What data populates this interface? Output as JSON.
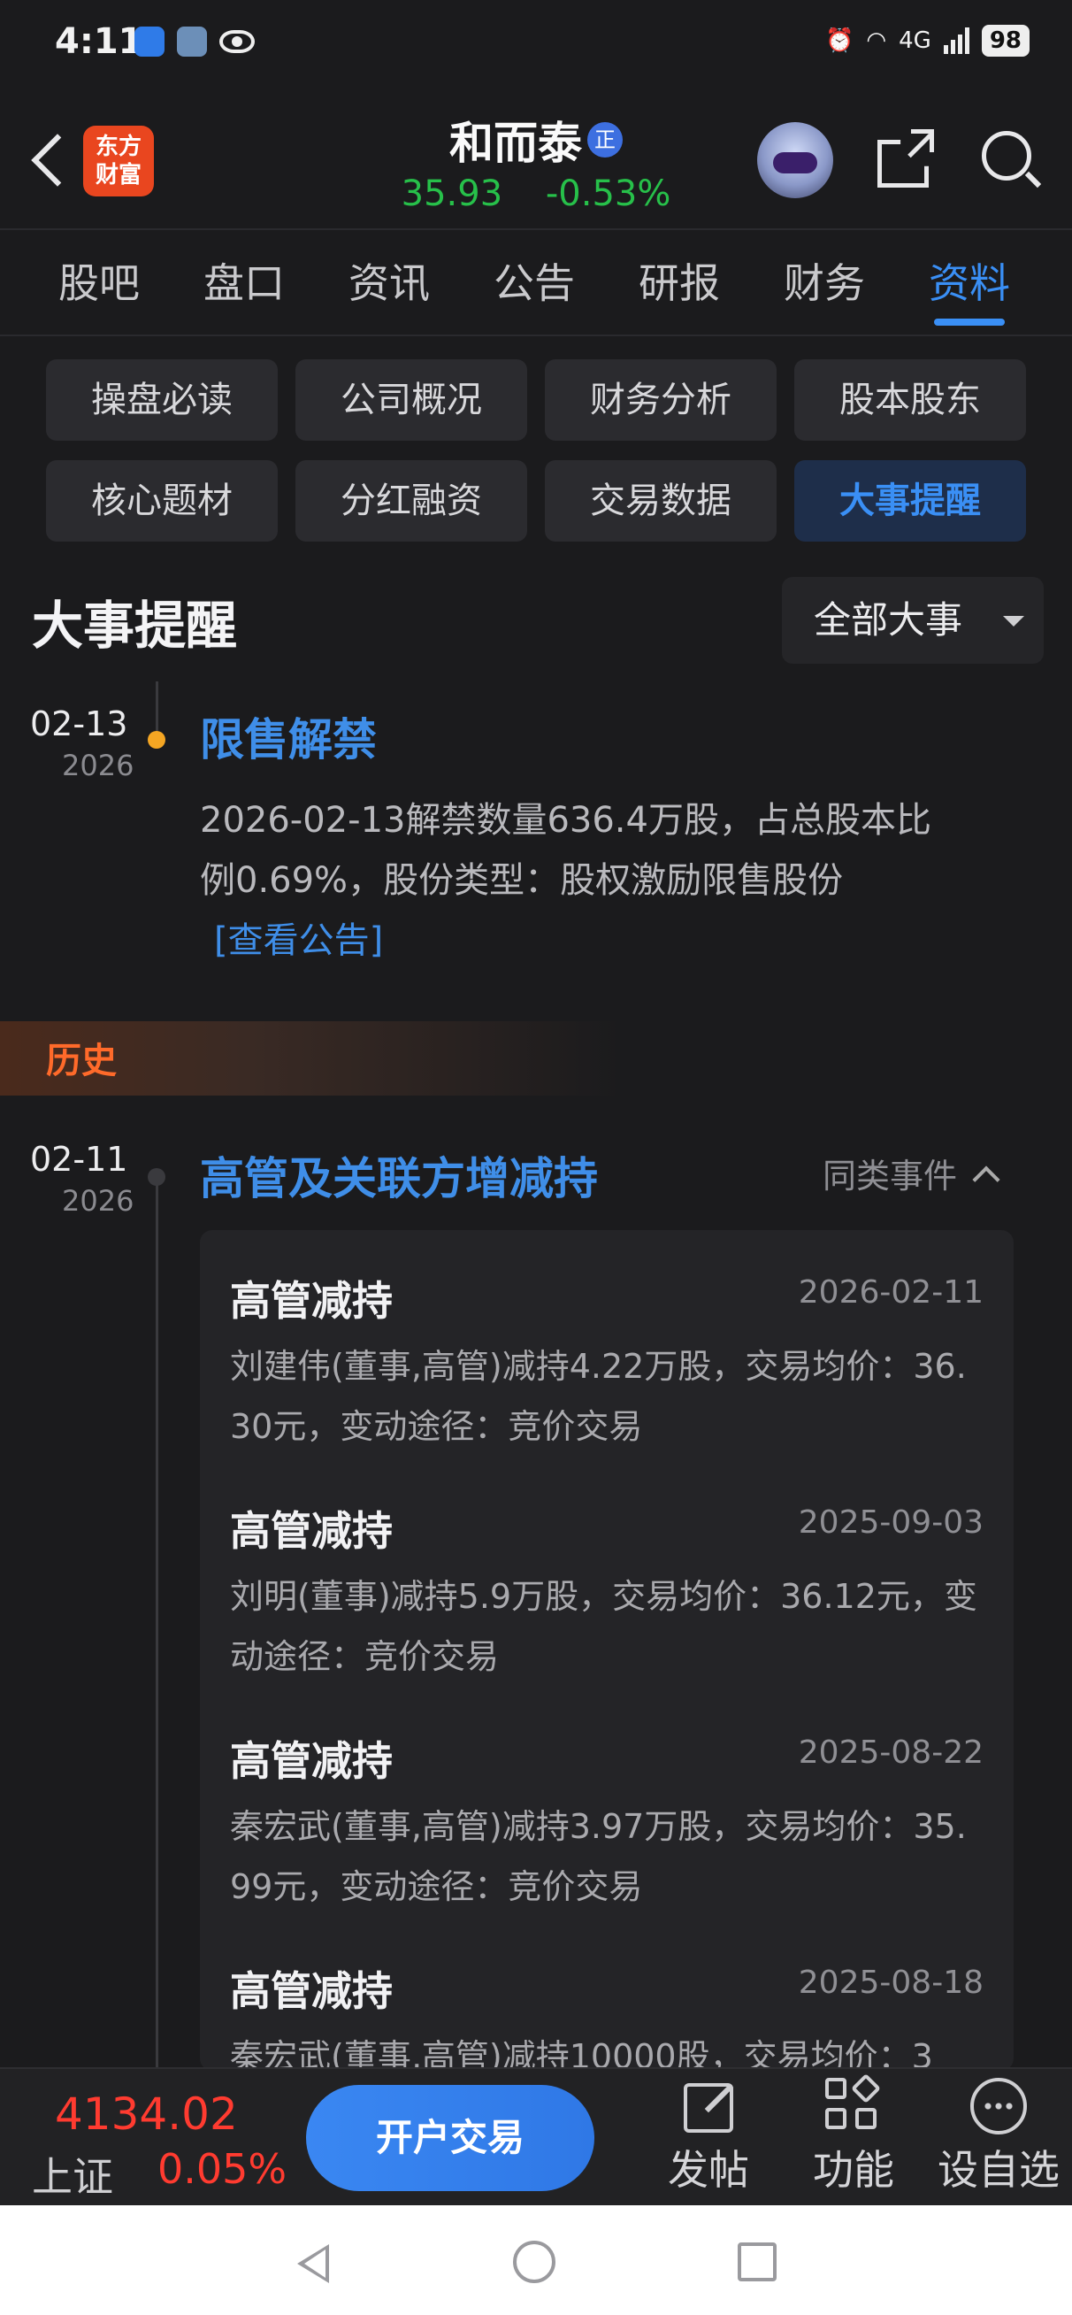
{
  "status_bar": {
    "time": "4:11",
    "network": "4G",
    "battery": "98"
  },
  "header": {
    "logo_line1": "东方",
    "logo_line2": "财富",
    "stock_name": "和而泰",
    "stock_badge": "正",
    "price": "35.93",
    "change_pct": "-0.53%",
    "price_color": "#27c04a"
  },
  "tabs": [
    {
      "label": "股吧"
    },
    {
      "label": "盘口"
    },
    {
      "label": "资讯"
    },
    {
      "label": "公告"
    },
    {
      "label": "研报"
    },
    {
      "label": "财务"
    },
    {
      "label": "资料",
      "active": true
    }
  ],
  "chips": [
    {
      "label": "操盘必读"
    },
    {
      "label": "公司概况"
    },
    {
      "label": "财务分析"
    },
    {
      "label": "股本股东"
    },
    {
      "label": "核心题材"
    },
    {
      "label": "分红融资"
    },
    {
      "label": "交易数据"
    },
    {
      "label": "大事提醒",
      "active": true
    }
  ],
  "section": {
    "title": "大事提醒",
    "filter": "全部大事"
  },
  "upcoming_event": {
    "date": "02-13",
    "year": "2026",
    "title": "限售解禁",
    "desc_line1": "2026-02-13解禁数量636.4万股，占总股本比",
    "desc_line2": "例0.69%，股份类型：股权激励限售股份",
    "link": "[查看公告]",
    "dot_color": "#f5a623"
  },
  "history_label": "历史",
  "history_event": {
    "date": "02-11",
    "year": "2026",
    "title": "高管及关联方增减持",
    "similar_label": "同类事件"
  },
  "records": [
    {
      "title": "高管减持",
      "date": "2026-02-11",
      "desc": "刘建伟(董事,高管)减持4.22万股，交易均价：36.30元，变动途径：竞价交易"
    },
    {
      "title": "高管减持",
      "date": "2025-09-03",
      "desc": "刘明(董事)减持5.9万股，交易均价：36.12元，变动途径：竞价交易"
    },
    {
      "title": "高管减持",
      "date": "2025-08-22",
      "desc": "秦宏武(董事,高管)减持3.97万股，交易均价：35.99元，变动途径：竞价交易"
    },
    {
      "title": "高管减持",
      "date": "2025-08-18",
      "desc": "秦宏武(董事,高管)减持10000股，交易均价：3"
    }
  ],
  "bottom_bar": {
    "index_value": "4134.02",
    "index_name": "上证",
    "index_change": "0.05%",
    "open_trade": "开户交易",
    "post": "发帖",
    "functions": "功能",
    "add_watch": "设自选"
  },
  "colors": {
    "accent": "#3a8ff5",
    "up": "#ff3b30",
    "down": "#27c04a",
    "history": "#ff6a2a"
  }
}
